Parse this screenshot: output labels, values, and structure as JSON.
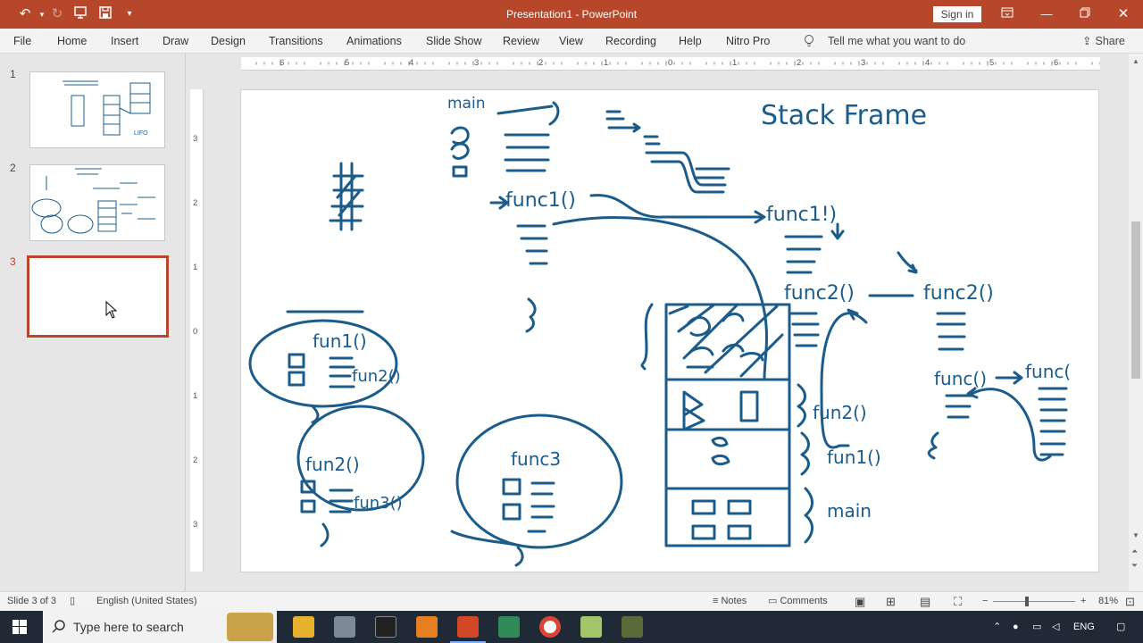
{
  "app": {
    "title": "Presentation1  -  PowerPoint",
    "signin": "Sign in",
    "share": "Share",
    "tell_me": "Tell me what you want to do"
  },
  "tabs": [
    "File",
    "Home",
    "Insert",
    "Draw",
    "Design",
    "Transitions",
    "Animations",
    "Slide Show",
    "Review",
    "View",
    "Recording",
    "Help",
    "Nitro Pro"
  ],
  "thumbnails": [
    {
      "num": "1"
    },
    {
      "num": "2"
    },
    {
      "num": "3"
    }
  ],
  "ruler": {
    "h": [
      "6",
      "5",
      "4",
      "3",
      "2",
      "1",
      "0",
      "1",
      "2",
      "3",
      "4",
      "5",
      "6"
    ],
    "v": [
      "3",
      "2",
      "1",
      "0",
      "1",
      "2",
      "3"
    ]
  },
  "slide_ink": {
    "title": "Stack Frame",
    "main": "main",
    "func1": "func1()",
    "func1b": "func1!)",
    "func2": "func2()",
    "func2b": "func2()",
    "func_r1": "func()",
    "func_r2": "func(",
    "frame_fun2": "fun2()",
    "frame_fun1": "fun1()",
    "frame_main": "main",
    "ov1_title": "fun1()",
    "ov1_call": "fun2()",
    "ov2_title": "fun2()",
    "ov2_call": "fun3()",
    "ov3_title": "func3"
  },
  "status": {
    "slide": "Slide 3 of 3",
    "lang": "English (United States)",
    "notes": "Notes",
    "comments": "Comments",
    "zoom": "81%"
  },
  "taskbar": {
    "search_placeholder": "Type here to search",
    "lang": "ENG"
  },
  "colors": {
    "accent": "#b7472a",
    "ink": "#1b5c8a"
  }
}
